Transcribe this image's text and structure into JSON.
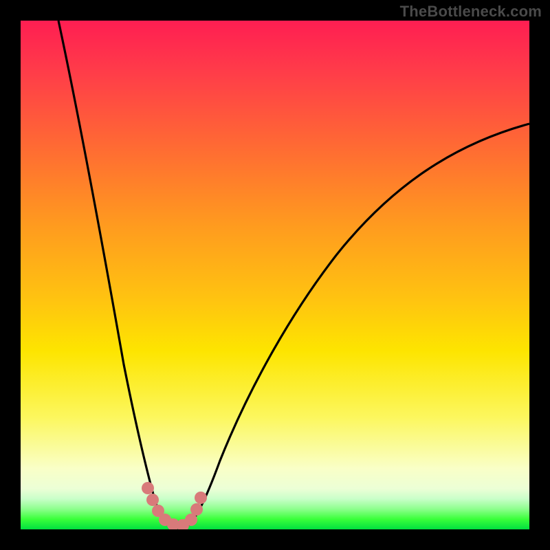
{
  "watermark": {
    "text": "TheBottleneck.com"
  },
  "chart_data": {
    "type": "line",
    "title": "",
    "xlabel": "",
    "ylabel": "",
    "xlim": [
      0,
      100
    ],
    "ylim": [
      0,
      100
    ],
    "grid": false,
    "legend": false,
    "gradient_colors": {
      "top": "#ff1e52",
      "upper_mid": "#ff9a1f",
      "mid": "#fde500",
      "lower_mid": "#f9ffc7",
      "bottom": "#00e040"
    },
    "series": [
      {
        "name": "bottleneck_curve_left",
        "x": [
          4,
          6,
          8,
          10,
          12,
          14,
          16,
          18,
          20,
          22,
          24,
          26,
          28
        ],
        "values": [
          100,
          90,
          79,
          68,
          57,
          46,
          36,
          27,
          18,
          11,
          6,
          2,
          0
        ]
      },
      {
        "name": "bottleneck_curve_right",
        "x": [
          32,
          34,
          36,
          40,
          45,
          50,
          55,
          60,
          65,
          70,
          75,
          80,
          85,
          90,
          95,
          100
        ],
        "values": [
          0,
          3,
          7,
          15,
          24,
          32,
          40,
          47,
          53,
          58,
          62,
          66,
          70,
          73,
          76,
          79
        ]
      },
      {
        "name": "highlight_markers",
        "x": [
          23,
          24,
          25,
          27,
          29,
          31,
          32,
          33,
          34
        ],
        "values": [
          8,
          5,
          3,
          1,
          1,
          1,
          2,
          4,
          7
        ]
      }
    ],
    "curve_minimum_x": 30
  }
}
